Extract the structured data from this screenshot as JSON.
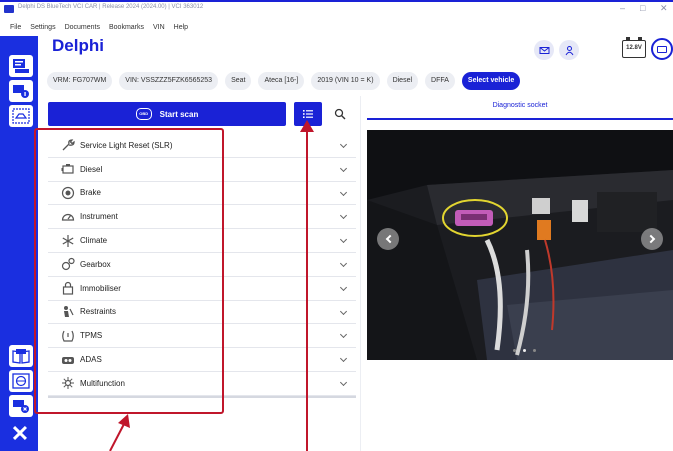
{
  "window": {
    "title": "Delphi DS BlueTech VCI CAR | Release 2024 (2024.00) | VCI 363012",
    "controls": [
      "–",
      "□",
      "✕"
    ]
  },
  "menu": [
    "File",
    "Settings",
    "Documents",
    "Bookmarks",
    "VIN",
    "Help"
  ],
  "sidebar": {
    "buttons": [
      {
        "icon": "vehicle-list-icon"
      },
      {
        "icon": "vehicle-info-icon"
      },
      {
        "icon": "diagnostics-icon"
      },
      {
        "icon": "book-icon"
      },
      {
        "icon": "globe-icon"
      },
      {
        "icon": "vci-disconnect-icon"
      }
    ],
    "close_label": "✕"
  },
  "header": {
    "brand": "Delphi",
    "battery_label": "12.8V",
    "icons": [
      "mail-icon",
      "user-icon",
      "battery-icon",
      "vci-connection-icon"
    ]
  },
  "vehicle_chips": [
    {
      "label": "VRM: FG707WM",
      "primary": false
    },
    {
      "label": "VIN: VSSZZZ5FZK6565253",
      "primary": false
    },
    {
      "label": "Seat",
      "primary": false
    },
    {
      "label": "Ateca [16-]",
      "primary": false
    },
    {
      "label": "2019 (VIN 10 = K)",
      "primary": false
    },
    {
      "label": "Diesel",
      "primary": false
    },
    {
      "label": "DFFA",
      "primary": false
    },
    {
      "label": "Select vehicle",
      "primary": true
    }
  ],
  "scan": {
    "start_label": "Start scan",
    "obd_text": "OBD"
  },
  "functions": [
    {
      "label": "Service Light Reset (SLR)",
      "icon": "wrench-icon"
    },
    {
      "label": "Diesel",
      "icon": "diesel-engine-icon"
    },
    {
      "label": "Brake",
      "icon": "brake-icon"
    },
    {
      "label": "Instrument",
      "icon": "gauge-icon"
    },
    {
      "label": "Climate",
      "icon": "snowflake-icon"
    },
    {
      "label": "Gearbox",
      "icon": "gears-icon"
    },
    {
      "label": "Immobiliser",
      "icon": "lock-icon"
    },
    {
      "label": "Restraints",
      "icon": "seat-belt-icon"
    },
    {
      "label": "TPMS",
      "icon": "tyre-pressure-icon"
    },
    {
      "label": "ADAS",
      "icon": "adas-icon"
    },
    {
      "label": "Multifunction",
      "icon": "multifunction-icon"
    }
  ],
  "right_pane": {
    "tab_label": "Diagnostic socket",
    "carousel_dots": 3,
    "active_dot": 1
  },
  "colors": {
    "accent": "#1a22d6",
    "sidebar": "#1a2fe0",
    "annotation": "#c0162b"
  }
}
